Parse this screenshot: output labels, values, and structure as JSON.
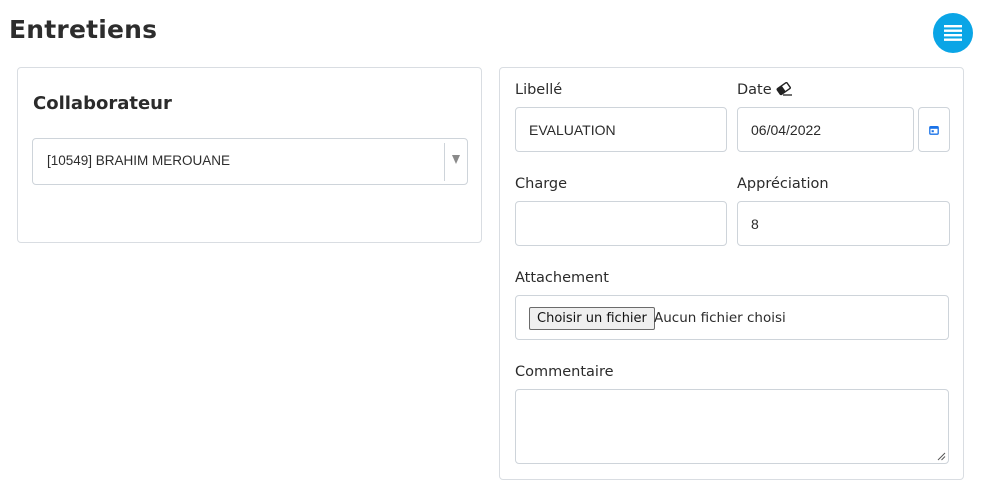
{
  "page": {
    "title": "Entretiens"
  },
  "collaborateur": {
    "heading": "Collaborateur",
    "selected": "[10549] BRAHIM MEROUANE"
  },
  "form": {
    "libelle": {
      "label": "Libellé",
      "value": "EVALUATION"
    },
    "date": {
      "label": "Date",
      "value": "06/04/2022",
      "clear_icon": "eraser-icon",
      "picker_icon": "calendar-icon"
    },
    "charge": {
      "label": "Charge",
      "value": ""
    },
    "appreciation": {
      "label": "Appréciation",
      "value": "8"
    },
    "attachement": {
      "label": "Attachement",
      "button_label": "Choisir un fichier",
      "status": "Aucun fichier choisi"
    },
    "commentaire": {
      "label": "Commentaire",
      "value": ""
    }
  },
  "colors": {
    "accent": "#0aa5e6",
    "border": "#ced4da",
    "calendar_icon": "#1a73e8"
  }
}
